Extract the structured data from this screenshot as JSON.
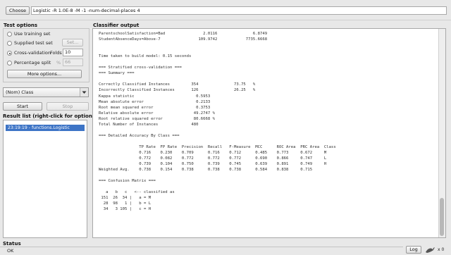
{
  "top": {
    "choose_label": "Choose",
    "classifier_command": "Logistic -R 1.0E-8 -M -1 -num-decimal-places 4"
  },
  "test_options": {
    "title": "Test options",
    "use_training_set": "Use training set",
    "supplied_test_set": "Supplied test set",
    "set_label": "Set...",
    "cross_validation": "Cross-validation",
    "folds_label": "Folds",
    "folds_value": "10",
    "percentage_split": "Percentage split",
    "percent_sign": "%",
    "percent_value": "66",
    "more_options": "More options...",
    "selected": "cross_validation"
  },
  "class_select": {
    "value": "(Nom) Class"
  },
  "actions": {
    "start_label": "Start",
    "stop_label": "Stop"
  },
  "result_list": {
    "title": "Result list (right-click for options)",
    "items": [
      "23:19:19 - functions.Logistic"
    ]
  },
  "classifier_output": {
    "title": "Classifier output",
    "lines": [
      "ParentschoolSatisfaction=Bad                2.0116               6.8749",
      "StudentAbsenceDays=Above-7                109.9742            7735.6668",
      "",
      "",
      "Time taken to build model: 0.15 seconds",
      "",
      "=== Stratified cross-validation ===",
      "=== Summary ===",
      "",
      "Correctly Classified Instances         354               73.75   %",
      "Incorrectly Classified Instances       126               26.25   %",
      "Kappa statistic                          0.5953",
      "Mean absolute error                      0.2133",
      "Root mean squared error                  0.3753",
      "Relative absolute error                 49.2747 %",
      "Root relative squared error             80.6668 %",
      "Total Number of Instances              480",
      "",
      "=== Detailed Accuracy By Class ===",
      "",
      "                 TP Rate  FP Rate  Precision  Recall   F-Measure  MCC      ROC Area  PRC Area  Class",
      "                 0.716    0.230    0.709      0.716    0.712      0.485    0.773     0.672     M",
      "                 0.772    0.082    0.772      0.772    0.772      0.690    0.866     0.747     L",
      "                 0.739    0.104    0.750      0.739    0.745      0.639    0.891     0.749     H",
      "Weighted Avg.    0.738    0.154    0.738      0.738    0.738      0.584    0.838     0.715",
      "",
      "=== Confusion Matrix ===",
      "",
      "   a   b   c   <-- classified as",
      " 151  26  34 |   a = M",
      "  28  98   1 |   b = L",
      "  34   3 105 |   c = H"
    ]
  },
  "status": {
    "title": "Status",
    "text": "OK",
    "log_label": "Log",
    "x_label": "x 0"
  }
}
